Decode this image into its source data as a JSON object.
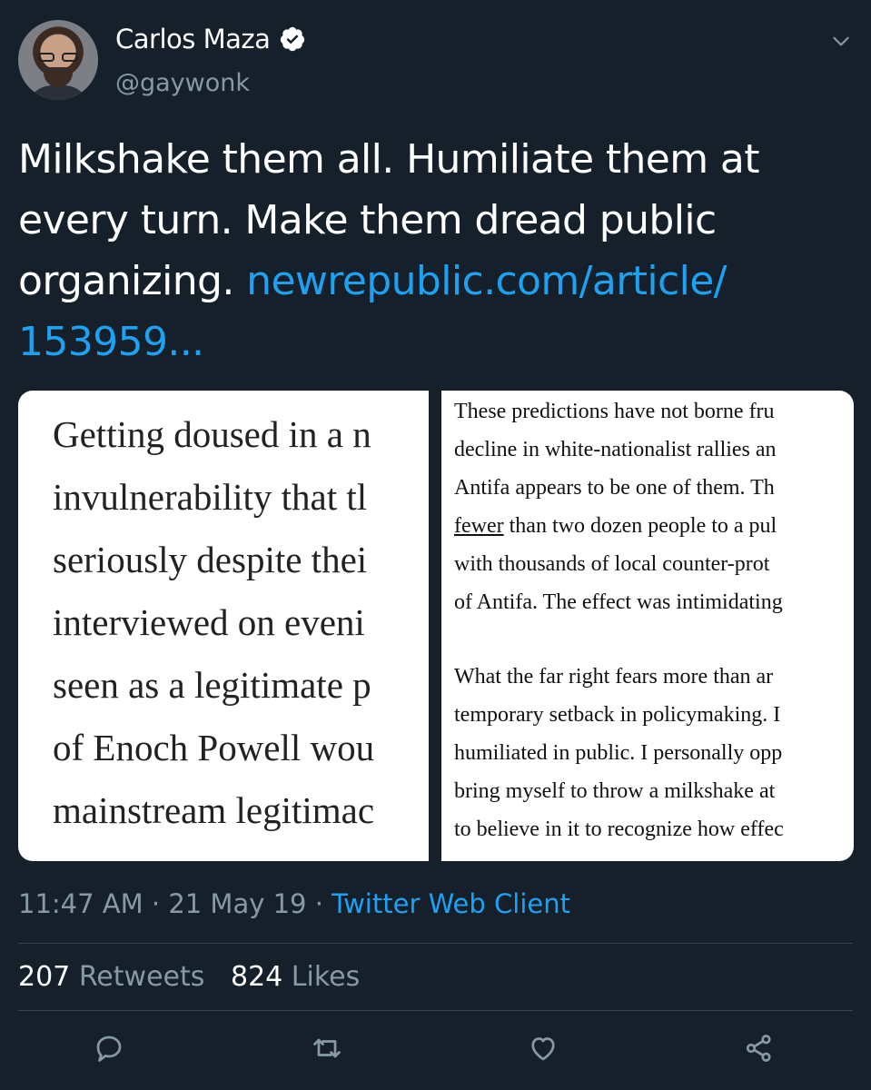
{
  "author": {
    "name": "Carlos Maza",
    "handle": "@gaywonk",
    "verified_icon": "verified-badge-icon"
  },
  "tweet": {
    "text": "Milkshake them all. Humiliate them at every turn. Make them dread public organizing.",
    "link_line1": "newrepublic.com/article/",
    "link_line2": "153959..."
  },
  "media": {
    "left_lines": [
      "Getting doused in a n",
      "invulnerability that tl",
      "seriously despite thei",
      "interviewed on eveni",
      "seen as a legitimate p",
      "of Enoch Powell wou",
      "mainstream legitimac"
    ],
    "right_lines": [
      "These predictions have not borne fru",
      "decline in white-nationalist rallies an",
      "Antifa appears to be one of them. Th",
      "than two dozen people to a pul",
      "with thousands of local counter-prot",
      "of Antifa. The effect was intimidating",
      "What the far right fears more than ar",
      "temporary setback in policymaking. I",
      "humiliated in public. I personally opp",
      "bring myself to throw a milkshake at",
      "to believe in it to recognize how effec"
    ],
    "right_underlined_word": "fewer"
  },
  "meta": {
    "time": "11:47 AM",
    "sep1": "·",
    "date": "21 May 19",
    "sep2": "·",
    "source": "Twitter Web Client"
  },
  "stats": {
    "retweets_count": "207",
    "retweets_label": "Retweets",
    "likes_count": "824",
    "likes_label": "Likes"
  },
  "colors": {
    "background": "#15202b",
    "link": "#1da1f2",
    "secondary_text": "#8899a6",
    "divider": "#38444d"
  }
}
